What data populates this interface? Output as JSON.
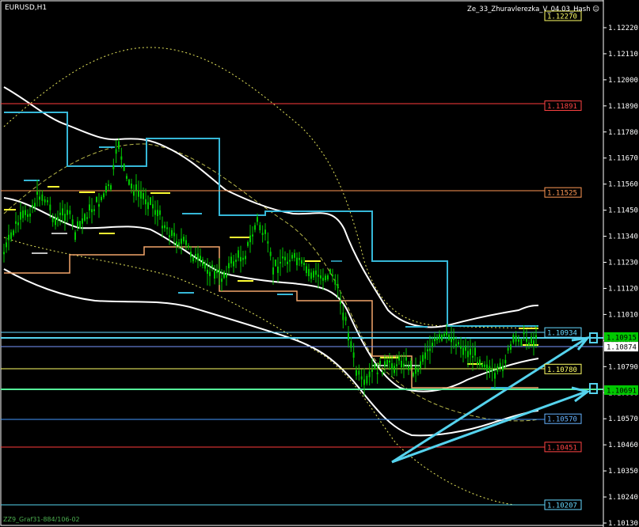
{
  "window": {
    "symbol_timeframe": "EURUSD,H1"
  },
  "indicator": {
    "label": "Ze_33_Zhuravlerezka_V_04.03_Hash",
    "icon": "smiley-icon"
  },
  "footer": {
    "label": "ZZ9_Graf31-884/106-02"
  },
  "colors": {
    "background": "#000000",
    "candle": "#00c800",
    "price_tag_green": "#00c800",
    "arrow": "#55d3ee"
  },
  "chart_data": {
    "type": "line",
    "symbol": "EURUSD",
    "timeframe": "H1",
    "ylim": [
      1.1013,
      1.1227
    ],
    "y_ticks": [
      "1.12220",
      "1.12110",
      "1.12000",
      "1.11890",
      "1.11780",
      "1.11670",
      "1.11560",
      "1.11450",
      "1.11340",
      "1.11230",
      "1.11120",
      "1.11010",
      "1.10900",
      "1.10790",
      "1.10680",
      "1.10570",
      "1.10460",
      "1.10350",
      "1.10240",
      "1.10130"
    ],
    "levels": [
      {
        "value": "1.12270",
        "color": "#ffff66"
      },
      {
        "value": "1.11891",
        "color": "#ff4444"
      },
      {
        "value": "1.11525",
        "color": "#ff9955"
      },
      {
        "value": "1.10934",
        "color": "#66d9ff"
      },
      {
        "value": "1.10780",
        "color": "#ffff66"
      },
      {
        "value": "1.10570",
        "color": "#66b3ff"
      },
      {
        "value": "1.10451",
        "color": "#ff4444"
      },
      {
        "value": "1.10207",
        "color": "#66d9ff"
      }
    ],
    "price_markers": [
      {
        "value": "1.10915",
        "color": "#00c800"
      },
      {
        "value": "1.10874",
        "color": "#ffffff"
      },
      {
        "value": "1.10691",
        "color": "#00c800"
      }
    ]
  }
}
